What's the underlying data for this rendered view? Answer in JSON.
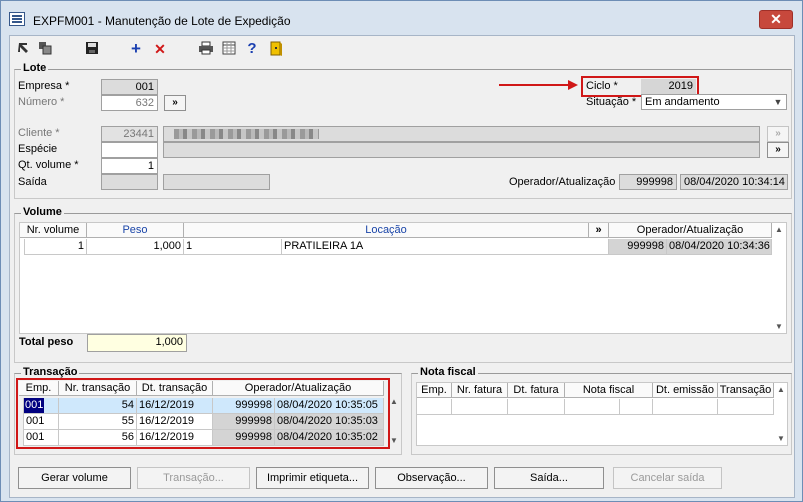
{
  "window": {
    "title": "EXPFM001 - Manutenção de Lote de Expedição",
    "close_label": "✕"
  },
  "toolbar": {
    "icons": [
      "navigate-icon",
      "copy-icon",
      "save-icon",
      "add-icon",
      "delete-icon",
      "print-icon",
      "table-icon",
      "help-icon",
      "exit-icon"
    ],
    "add_glyph": "+",
    "delete_glyph": "✕",
    "help_glyph": "?"
  },
  "lote": {
    "title": "Lote",
    "empresa_label": "Empresa *",
    "empresa_value": "001",
    "numero_label": "Número *",
    "numero_value": "632",
    "ciclo_label": "Ciclo *",
    "ciclo_value": "2019",
    "situacao_label": "Situação *",
    "situacao_value": "Em andamento",
    "cliente_label": "Cliente *",
    "cliente_value": "23441",
    "especie_label": "Espécie",
    "especie_value": "",
    "qt_volume_label": "Qt. volume *",
    "qt_volume_value": "1",
    "saida_label": "Saída",
    "operador_label": "Operador/Atualização",
    "operador_value": "999998",
    "atualizacao_value": "08/04/2020 10:34:14",
    "nav_glyph": "»"
  },
  "volume": {
    "title": "Volume",
    "columns": [
      "Nr. volume",
      "Peso",
      "Locação",
      "»",
      "Operador/Atualização"
    ],
    "rows": [
      {
        "nr": "1",
        "peso": "1,000",
        "loc_code": "1",
        "loc_name": "PRATILEIRA 1A",
        "operador": "999998",
        "data": "08/04/2020 10:34:36"
      }
    ],
    "total_label": "Total peso",
    "total_value": "1,000"
  },
  "transacao": {
    "title": "Transação",
    "columns": [
      "Emp.",
      "Nr. transação",
      "Dt. transação",
      "Operador/Atualização"
    ],
    "rows": [
      {
        "emp": "001",
        "nr": "54",
        "dt": "16/12/2019",
        "operador": "999998",
        "data": "08/04/2020 10:35:05"
      },
      {
        "emp": "001",
        "nr": "55",
        "dt": "16/12/2019",
        "operador": "999998",
        "data": "08/04/2020 10:35:03"
      },
      {
        "emp": "001",
        "nr": "56",
        "dt": "16/12/2019",
        "operador": "999998",
        "data": "08/04/2020 10:35:02"
      }
    ]
  },
  "nota_fiscal": {
    "title": "Nota fiscal",
    "columns": [
      "Emp.",
      "Nr. fatura",
      "Dt. fatura",
      "Nota fiscal",
      "Dt. emissão",
      "Transação"
    ]
  },
  "buttons": {
    "gerar_volume": "Gerar volume",
    "transacao": "Transação...",
    "imprimir": "Imprimir etiqueta...",
    "observacao": "Observação...",
    "saida": "Saída...",
    "cancelar_saida": "Cancelar saída"
  }
}
